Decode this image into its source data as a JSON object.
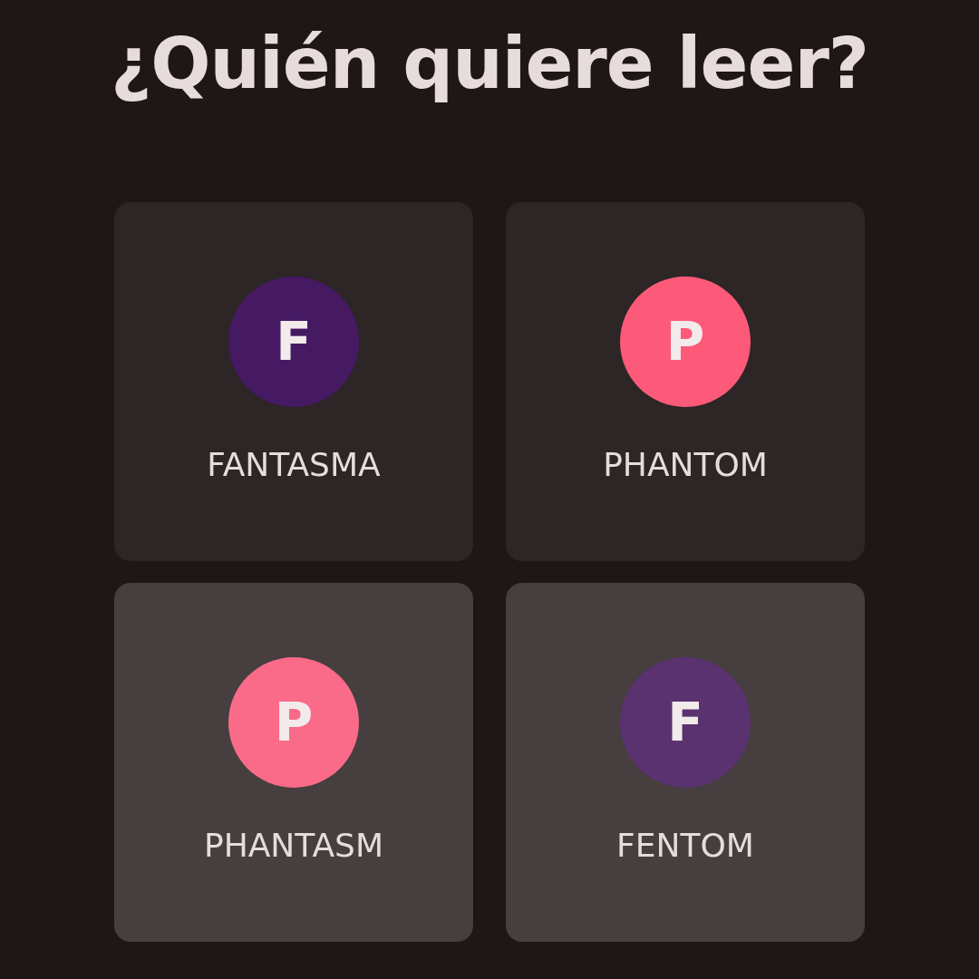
{
  "title": "¿Quién quiere leer?",
  "profiles": [
    {
      "initial": "F",
      "name": "FANTASMA",
      "color": "#451a63",
      "highlighted": false
    },
    {
      "initial": "P",
      "name": "PHANTOM",
      "color": "#fc5a78",
      "highlighted": false
    },
    {
      "initial": "P",
      "name": "PHANTASM",
      "color": "#f96b88",
      "highlighted": true
    },
    {
      "initial": "F",
      "name": "FENTOM",
      "color": "#5a3270",
      "highlighted": true
    }
  ]
}
